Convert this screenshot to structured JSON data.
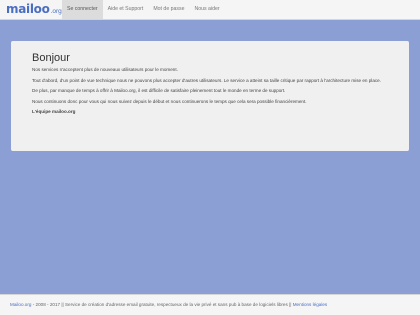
{
  "header": {
    "logo_text": "mailoo",
    "logo_suffix": ".org",
    "nav": [
      {
        "label": "Se connecter",
        "active": true
      },
      {
        "label": "Aide et Support",
        "active": false
      },
      {
        "label": "Mot de passe",
        "active": false
      },
      {
        "label": "Nous aider",
        "active": false
      }
    ]
  },
  "main": {
    "title": "Bonjour",
    "paragraphs": [
      "Nos services n'acceptent plus de nouveaux utilisateurs pour le moment.",
      "Tout d'abord, d'un point de vue technique nous ne pouvons plus accepter d'autres utilisateurs. Le service a atteint sa taille critique par rapport à l'architecture mise en place.",
      "De plus, par manque de temps à offrir à Mailoo.org, il est difficile de satisfaire pleinement tout le monde en terme de support.",
      "Nous continuons donc pour vous qui nous suivez depuis le début et nous continuerons le temps que cela sera possible financièrement."
    ],
    "signature": "L'équipe mailoo.org"
  },
  "footer": {
    "site_link": "Mailoo.org",
    "text": " - 2008 - 2017 || Service de création d'adresse email gratuite, respectueux de la vie privé et sans pub à base de logiciels libres || ",
    "legal_link": "Mentions légales"
  },
  "colors": {
    "background": "#8b9fd4",
    "brand": "#4a6fc2",
    "card": "#f0f0f0"
  }
}
